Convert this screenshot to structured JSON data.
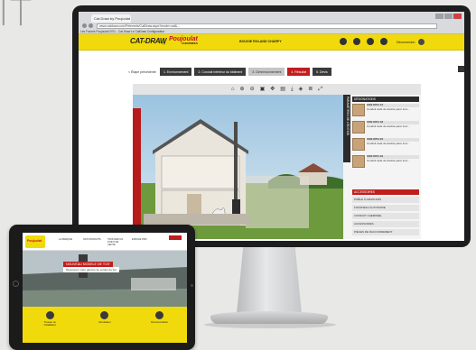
{
  "hero_text": "IT",
  "browser": {
    "tab_title": "Cat-Draw by Poujoulat",
    "address": "www.catdraw.com/Pelemets/CatDraw.aspx?mode=cat&...",
    "bookmarks": "Les Favoris   Poujoulat DVO...   Cat Draw   Le CatDraw   Configurateur"
  },
  "app": {
    "brand": "CAT-DRAW",
    "brand_by": "by",
    "brand_partner": "Poujoulat",
    "brand_partner_sub": "CHEMINÉES",
    "header_mid": "BOUGIE ROLAND CHARPY",
    "header_right": "Déconnexion",
    "steps": {
      "back": "< Étape précédente",
      "items": [
        {
          "label": "1. Environnement",
          "style": "dark"
        },
        {
          "label": "2. Conduit intérieur du bâtiment",
          "style": "dark"
        },
        {
          "label": "3. Dimensionnement",
          "style": "grey"
        },
        {
          "label": "4. Résultat",
          "style": "red"
        },
        {
          "label": "5. Devis",
          "style": "dark"
        }
      ]
    },
    "toolbar_icons": [
      "home-icon",
      "zoom-in-icon",
      "zoom-out-icon",
      "fit-icon",
      "move-icon",
      "print-icon",
      "download-icon",
      "3d-icon",
      "layers-icon",
      "fullscreen-icon"
    ],
    "side_tab": "PARAMÈTRES DE L'ÉDITION",
    "products_header": "DÉSIGNATIONS",
    "products": [
      {
        "ref": "CEN 8704 13",
        "desc": "Conduit isolé de double paroi inox..."
      },
      {
        "ref": "CEN 8704 18",
        "desc": "Conduit isolé de double paroi inox..."
      },
      {
        "ref": "CEN 8704 23",
        "desc": "Conduit isolé de double paroi inox..."
      },
      {
        "ref": "CEN 8704 19",
        "desc": "Conduit isolé de double paroi inox..."
      }
    ],
    "rows_header": "ACCESSOIRES",
    "rows": [
      "POÊLE À GRANULÉS",
      "FOURNEAU AUTONOME",
      "CONDUIT CHEMINÉE",
      "ACCESSOIRES",
      "PIÈCES DE RACCORDEMENT"
    ]
  },
  "tablet": {
    "logo": "Poujoulat",
    "nav": [
      "LA MARQUE",
      "NOS PRODUITS",
      "TROUVER UN POINT DE VENTE",
      "ESPACE PRO"
    ],
    "caption": "NOUVEAU MODELE DE TOIT",
    "caption2": "Découvrez notre gamme de sorties de toit",
    "icons": [
      {
        "label": "Trouver un installateur"
      },
      {
        "label": "Simulateur"
      },
      {
        "label": "Documentation"
      }
    ]
  }
}
